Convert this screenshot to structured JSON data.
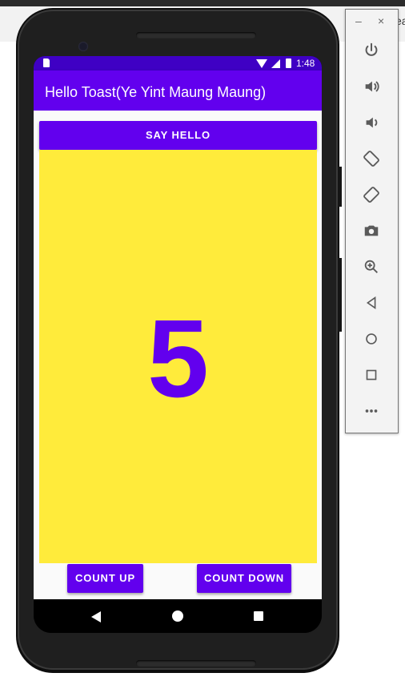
{
  "host": {
    "partial_text": "ea"
  },
  "status_bar": {
    "time": "1:48"
  },
  "app_bar": {
    "title": "Hello Toast(Ye Yint Maung Maung)"
  },
  "main": {
    "say_hello_label": "SAY HELLO",
    "count": "5",
    "count_up_label": "COUNT UP",
    "count_down_label": "COUNT DOWN"
  },
  "emulator_panel": {
    "minimize_glyph": "–",
    "close_glyph": "×",
    "icons": [
      "power-icon",
      "volume-up-icon",
      "volume-down-icon",
      "rotate-left-icon",
      "rotate-right-icon",
      "camera-icon",
      "zoom-icon",
      "back-icon",
      "home-icon",
      "overview-icon",
      "more-icon"
    ]
  },
  "colors": {
    "primary": "#6200ee",
    "primary_dark": "#3f00c4",
    "count_background": "#ffeb3b"
  }
}
